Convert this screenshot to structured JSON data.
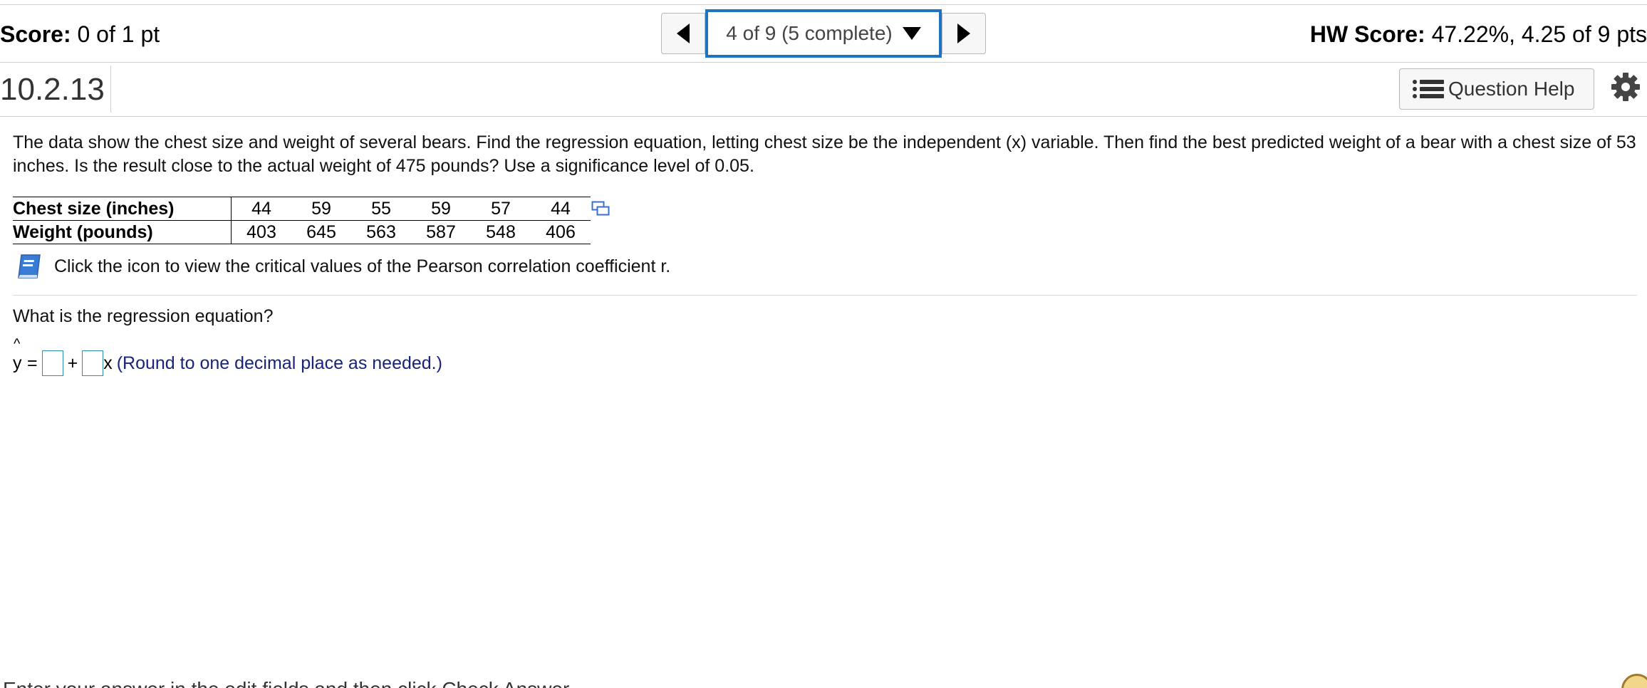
{
  "header": {
    "score_label": "Score:",
    "score_value": " 0 of 1 pt",
    "nav_position": "4 of 9 (5 complete)",
    "hw_label": "HW Score:",
    "hw_value": " 47.22%, 4.25 of 9 pts"
  },
  "question": {
    "number": "10.2.13",
    "help_label": "Question Help",
    "prompt": "The data show the chest size and weight of several bears. Find the regression equation, letting chest size be the independent (x) variable. Then find the best predicted weight of a bear with a chest size of 53 inches. Is the result close to the actual weight of 475 pounds? Use a significance level of 0.05.",
    "table": {
      "row1_label": "Chest size (inches)",
      "row1_values": [
        "44",
        "59",
        "55",
        "59",
        "57",
        "44"
      ],
      "row2_label": "Weight (pounds)",
      "row2_values": [
        "403",
        "645",
        "563",
        "587",
        "548",
        "406"
      ]
    },
    "critical_values_text": "Click the icon to view the critical values of the Pearson correlation coefficient r.",
    "sub_question": "What is the regression equation?",
    "equation": {
      "y_symbol": "y",
      "hat_symbol": "^",
      "equals": "=",
      "plus": "+",
      "x_symbol": "x",
      "hint": "(Round to one decimal place as needed.)"
    }
  },
  "footer": {
    "instruction": "Enter your answer in the edit fields and then click Check Answer."
  },
  "icons": {
    "prev": "triangle-left",
    "next": "triangle-right",
    "dropdown": "triangle-down",
    "help_list": "list-icon",
    "settings": "gear-icon",
    "copy": "copy-icon",
    "book": "book-icon"
  },
  "colors": {
    "nav_focus_border": "#1f73c0",
    "hint_text": "#17247a",
    "answer_box_border": "#2a8fb0",
    "book_icon": "#3a7bd5"
  }
}
